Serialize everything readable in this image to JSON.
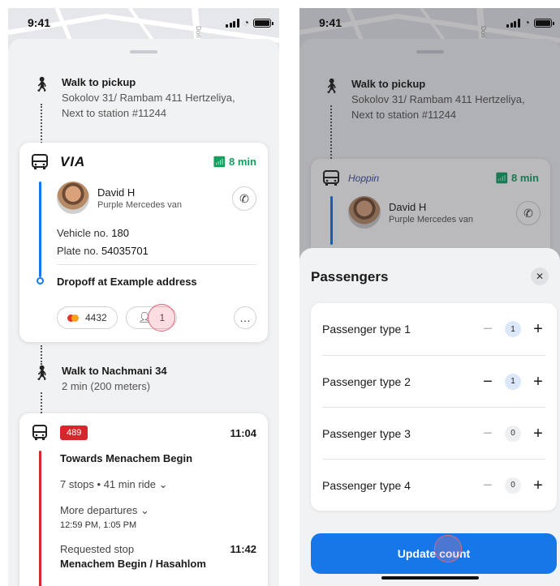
{
  "status": {
    "time": "9:41"
  },
  "map": {
    "street_label": "Dori St"
  },
  "left": {
    "walk1": {
      "title": "Walk to pickup",
      "address": "Sokolov 31/ Rambam 411 Hertzeliya, Next to station #11244"
    },
    "ride": {
      "brand": "VIA",
      "eta": "8 min",
      "driver_name": "David H",
      "driver_car": "Purple Mercedes van",
      "vehicle_label": "Vehicle no.",
      "vehicle_no": "180",
      "plate_label": "Plate no.",
      "plate_no": "54035701",
      "dropoff": "Dropoff at Example address",
      "card_last4": "4432",
      "passenger_count": "1",
      "route_color": "#1677e8"
    },
    "walk2": {
      "title": "Walk to Nachmani 34",
      "sub": "2 min (200 meters)"
    },
    "bus": {
      "number": "489",
      "depart_time": "11:04",
      "towards": "Towards Menachem Begin",
      "stops": "7 stops • 41 min ride",
      "more": "More departures",
      "times": "12:59 PM, 1:05 PM",
      "requested": "Requested stop",
      "arrive_time": "11:42",
      "stop_name": "Menachem Begin / Hasahlom",
      "route_color": "#d8262d"
    }
  },
  "right": {
    "walk1": {
      "title": "Walk to pickup",
      "address": "Sokolov 31/ Rambam 411 Hertzeliya, Next to station #11244"
    },
    "ride": {
      "brand": "Hoppin",
      "eta": "8 min",
      "driver_name": "David H",
      "driver_car": "Purple Mercedes van"
    },
    "passengers": {
      "title": "Passengers",
      "types": [
        {
          "label": "Passenger type 1",
          "count": "1"
        },
        {
          "label": "Passenger type 2",
          "count": "1"
        },
        {
          "label": "Passenger type 3",
          "count": "0"
        },
        {
          "label": "Passenger type 4",
          "count": "0"
        }
      ],
      "update_label": "Update count"
    }
  },
  "colors": {
    "accent": "#1677e8",
    "eta_green": "#13a05f",
    "bus_red": "#d8262d"
  }
}
